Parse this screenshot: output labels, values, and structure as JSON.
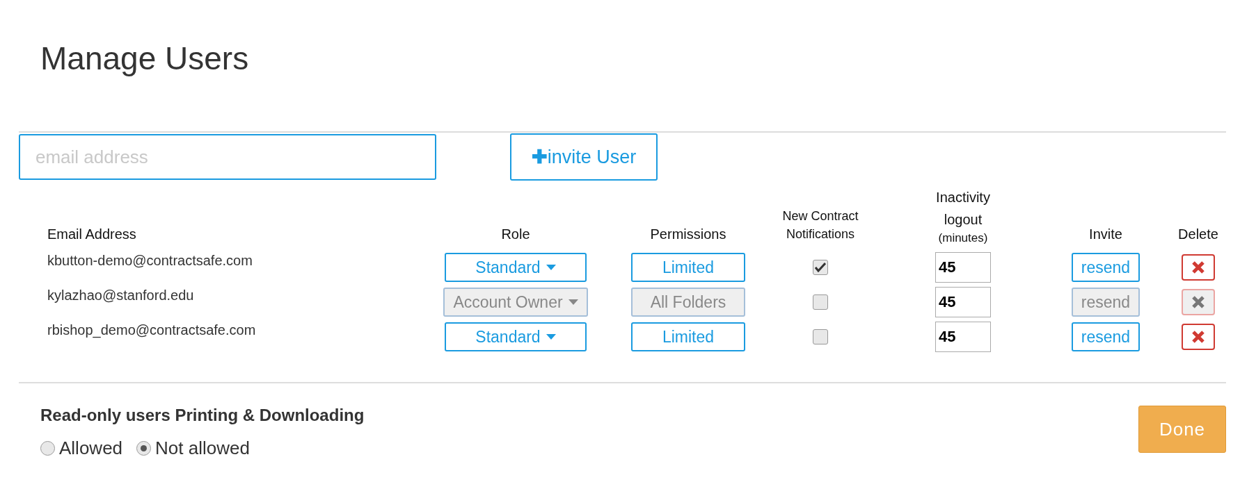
{
  "title": "Manage Users",
  "invite_form": {
    "email_placeholder": "email address",
    "invite_icon": "✚",
    "invite_label": "invite User"
  },
  "table": {
    "columns": [
      {
        "label": "Email Address"
      },
      {
        "label": "Role"
      },
      {
        "label": "Permissions"
      },
      {
        "label": "New Contract Notifications"
      },
      {
        "label": "Inactivity logout",
        "sublabel": "(minutes)"
      },
      {
        "label": "Invite"
      },
      {
        "label": "Delete"
      }
    ],
    "rows": [
      {
        "email": "kbutton-demo@contractsafe.com",
        "role": "Standard",
        "permissions": "Limited",
        "notifications_checked": true,
        "inactivity": "45",
        "invite": "resend",
        "disabled": false
      },
      {
        "email": "kylazhao@stanford.edu",
        "role": "Account Owner",
        "permissions": "All Folders",
        "notifications_checked": false,
        "inactivity": "45",
        "invite": "resend",
        "disabled": true
      },
      {
        "email": "rbishop_demo@contractsafe.com",
        "role": "Standard",
        "permissions": "Limited",
        "notifications_checked": false,
        "inactivity": "45",
        "invite": "resend",
        "disabled": false
      }
    ]
  },
  "printing": {
    "heading": "Read-only users Printing & Downloading",
    "options": [
      {
        "label": "Allowed",
        "selected": false
      },
      {
        "label": "Not allowed",
        "selected": true
      }
    ]
  },
  "done_button": "Done"
}
